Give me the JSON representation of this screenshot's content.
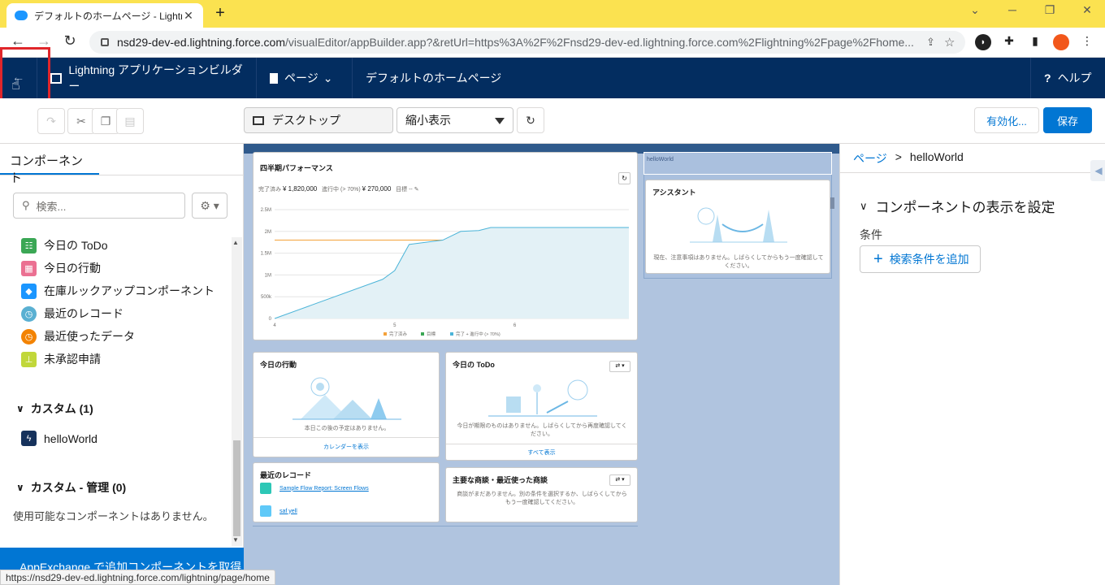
{
  "browser": {
    "tab_title": "デフォルトのホームページ - Lightning",
    "tab_close": "✕",
    "new_tab": "+",
    "url_host": "nsd29-dev-ed.lightning.force.com",
    "url_rest": "/visualEditor/appBuilder.app?&retUrl=https%3A%2F%2Fnsd29-dev-ed.lightning.force.com%2Flightning%2Fpage%2Fhome...",
    "status_url": "https://nsd29-dev-ed.lightning.force.com/lightning/page/home"
  },
  "header": {
    "app_builder": "Lightning アプリケーションビルダー",
    "page_menu": "ページ",
    "page_name": "デフォルトのホームページ",
    "help": "ヘルプ",
    "back_tooltip": "戻る"
  },
  "toolbar": {
    "device": "デスクトップ",
    "zoom": "縮小表示",
    "activate": "有効化...",
    "save": "保存"
  },
  "left": {
    "tab": "コンポーネント",
    "search_placeholder": "検索...",
    "items": [
      {
        "label": "今日の ToDo",
        "color": "#3ba755"
      },
      {
        "label": "今日の行動",
        "color": "#eb7092"
      },
      {
        "label": "在庫ルックアップコンポーネント",
        "color": "#1b96ff"
      },
      {
        "label": "最近のレコード",
        "color": "#5ab0d2"
      },
      {
        "label": "最近使ったデータ",
        "color": "#f38303"
      },
      {
        "label": "未承認申請",
        "color": "#c1d73a"
      }
    ],
    "custom_section": "カスタム (1)",
    "custom_items": [
      {
        "label": "helloWorld",
        "color": "#16325c"
      }
    ],
    "managed_section": "カスタム - 管理 (0)",
    "managed_empty": "使用可能なコンポーネントはありません。",
    "appexchange": "AppExchange で追加コンポーネントを取得"
  },
  "canvas": {
    "perf_title": "四半期パフォーマンス",
    "perf_closed_label": "完了済み",
    "perf_closed": "¥ 1,820,000",
    "perf_open_label": "進行中 (> 70%)",
    "perf_open": "¥ 270,000",
    "perf_goal_label": "目標",
    "perf_goal": "--",
    "legend": [
      "完了済み",
      "目標",
      "完了 + 進行中 (> 70%)"
    ],
    "hello_label": "helloWorld",
    "assistant_title": "アシスタント",
    "assistant_msg": "現在、注意事項はありません。しばらくしてからもう一度確認してください。",
    "events_title": "今日の行動",
    "events_msg": "本日この後の予定はありません。",
    "events_link": "カレンダーを表示",
    "todo_title": "今日の ToDo",
    "todo_msg": "今日が期限のものはありません。しばらくしてから再度確認してください。",
    "todo_link": "すべて表示",
    "recent_title": "最近のレコード",
    "recent_items": [
      "Sample Flow Report: Screen Flows",
      "saf yell"
    ],
    "deals_title": "主要な商談・最近使った商談",
    "deals_msg": "商談がまだありません。別の条件を選択するか、しばらくしてからもう一度確認してください。"
  },
  "chart_data": {
    "type": "line",
    "title": "四半期パフォーマンス",
    "x_ticks": [
      "4",
      "5",
      "6"
    ],
    "y_ticks": [
      "0",
      "500k",
      "1M",
      "1.5M",
      "2M",
      "2.5M"
    ],
    "ylim": [
      0,
      2500000
    ],
    "series": [
      {
        "name": "完了済み",
        "color": "#f4a23b",
        "points": [
          [
            4.0,
            1800000
          ],
          [
            6.95,
            1800000
          ]
        ]
      },
      {
        "name": "完了 + 進行中 (> 70%)",
        "color": "#4bb4d8",
        "points": [
          [
            4.0,
            0
          ],
          [
            4.9,
            900000
          ],
          [
            5.0,
            1100000
          ],
          [
            5.12,
            1700000
          ],
          [
            5.4,
            1800000
          ],
          [
            5.55,
            2000000
          ],
          [
            5.7,
            2020000
          ],
          [
            5.8,
            2090000
          ],
          [
            6.95,
            2090000
          ]
        ]
      }
    ],
    "grid": true,
    "legend_position": "bottom"
  },
  "right": {
    "breadcrumb_root": "ページ",
    "breadcrumb_sep": ">",
    "breadcrumb_current": "helloWorld",
    "visibility_heading": "コンポーネントの表示を設定",
    "conditions_label": "条件",
    "add_filter": "検索条件を追加"
  }
}
